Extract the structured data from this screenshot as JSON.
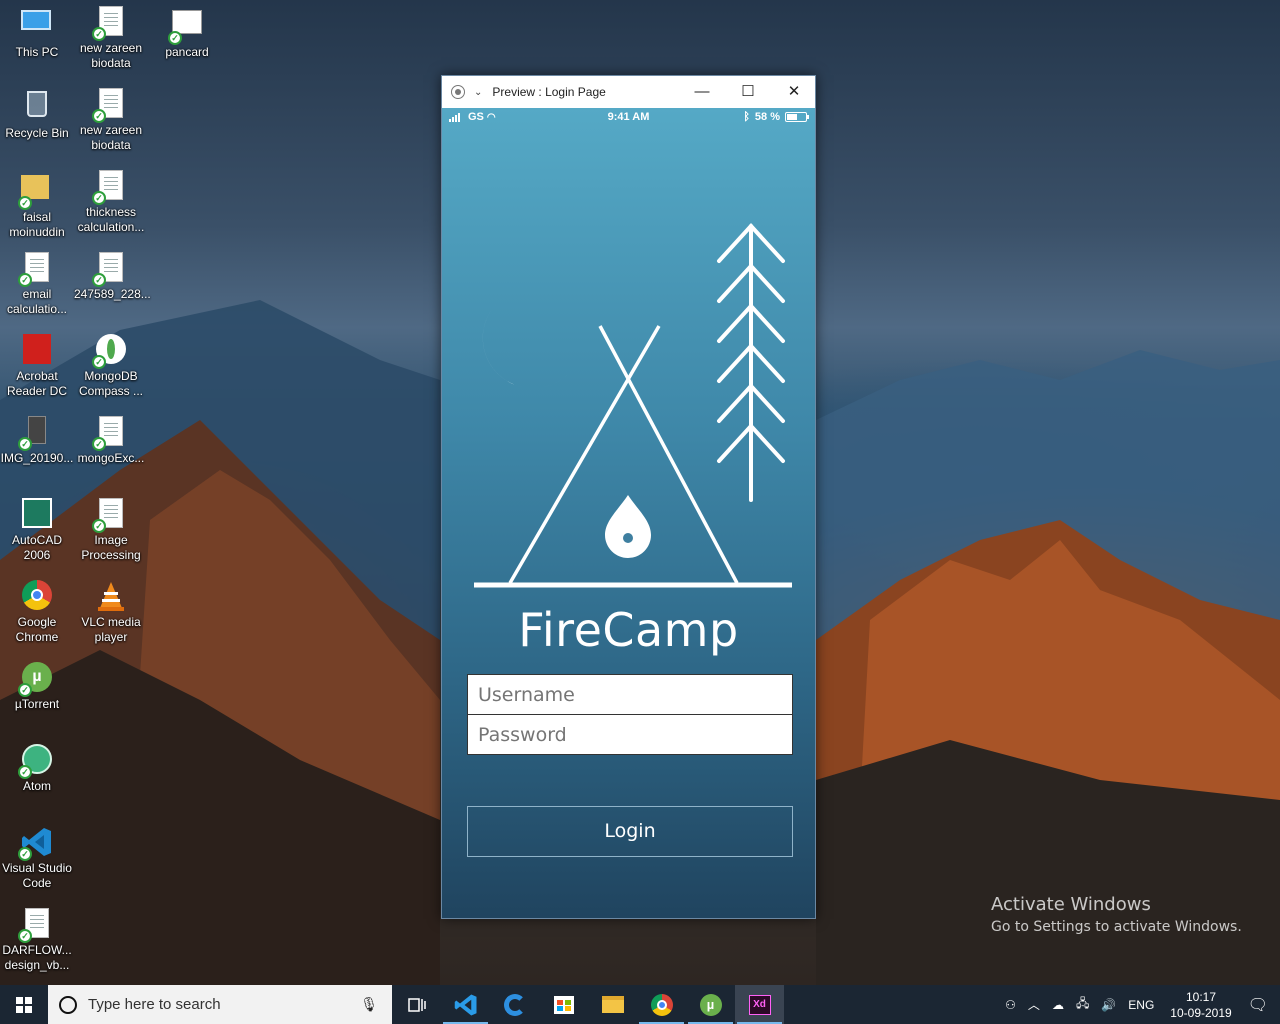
{
  "desktop": {
    "icons": [
      {
        "label": "This PC",
        "icon": "computer-icon"
      },
      {
        "label": "new zareen biodata",
        "icon": "document-icon"
      },
      {
        "label": "pancard",
        "icon": "image-file-icon"
      },
      {
        "label": "Recycle Bin",
        "icon": "recycle-bin-icon"
      },
      {
        "label": "new zareen biodata",
        "icon": "document-icon"
      },
      {
        "label": "faisal moinuddin",
        "icon": "user-folder-icon"
      },
      {
        "label": "thickness calculation...",
        "icon": "spreadsheet-icon"
      },
      {
        "label": "email calculatio...",
        "icon": "pdf-icon"
      },
      {
        "label": "247589_228...",
        "icon": "document-icon"
      },
      {
        "label": "Acrobat Reader DC",
        "icon": "acrobat-icon"
      },
      {
        "label": "MongoDB Compass ...",
        "icon": "mongodb-icon"
      },
      {
        "label": "IMG_20190...",
        "icon": "image-file-icon"
      },
      {
        "label": "mongoExc...",
        "icon": "document-icon"
      },
      {
        "label": "AutoCAD 2006",
        "icon": "autocad-icon"
      },
      {
        "label": "Image Processing",
        "icon": "document-icon"
      },
      {
        "label": "Google Chrome",
        "icon": "chrome-icon"
      },
      {
        "label": "VLC media player",
        "icon": "vlc-icon"
      },
      {
        "label": "µTorrent",
        "icon": "utorrent-icon"
      },
      {
        "label": "Atom",
        "icon": "atom-icon"
      },
      {
        "label": "Visual Studio Code",
        "icon": "vscode-icon"
      },
      {
        "label": "DARFLOW... design_vb...",
        "icon": "spreadsheet-icon"
      }
    ]
  },
  "window": {
    "title": "Preview : Login Page",
    "minimize": "—",
    "maximize": "☐",
    "close": "✕"
  },
  "phone": {
    "status": {
      "carrier": "GS",
      "time": "9:41 AM",
      "battery": "58 %",
      "battery_level": 0.58
    },
    "app_title": "FireCamp",
    "username_placeholder": "Username",
    "password_placeholder": "Password",
    "login_label": "Login"
  },
  "watermark": {
    "line1": "Activate Windows",
    "line2": "Go to Settings to activate Windows."
  },
  "taskbar": {
    "search_placeholder": "Type here to search",
    "apps": [
      "task-view-icon",
      "vscode-icon",
      "edge-icon",
      "store-icon",
      "file-explorer-icon",
      "chrome-icon",
      "utorrent-icon",
      "adobe-xd-icon"
    ],
    "xd_label": "Xd",
    "lang": "ENG",
    "time": "10:17",
    "date": "10-09-2019"
  },
  "colors": {
    "phone_top": "#55a9c6",
    "phone_bottom": "#20445f",
    "taskbar": "#1b2633",
    "accent": "#76b9ed"
  }
}
